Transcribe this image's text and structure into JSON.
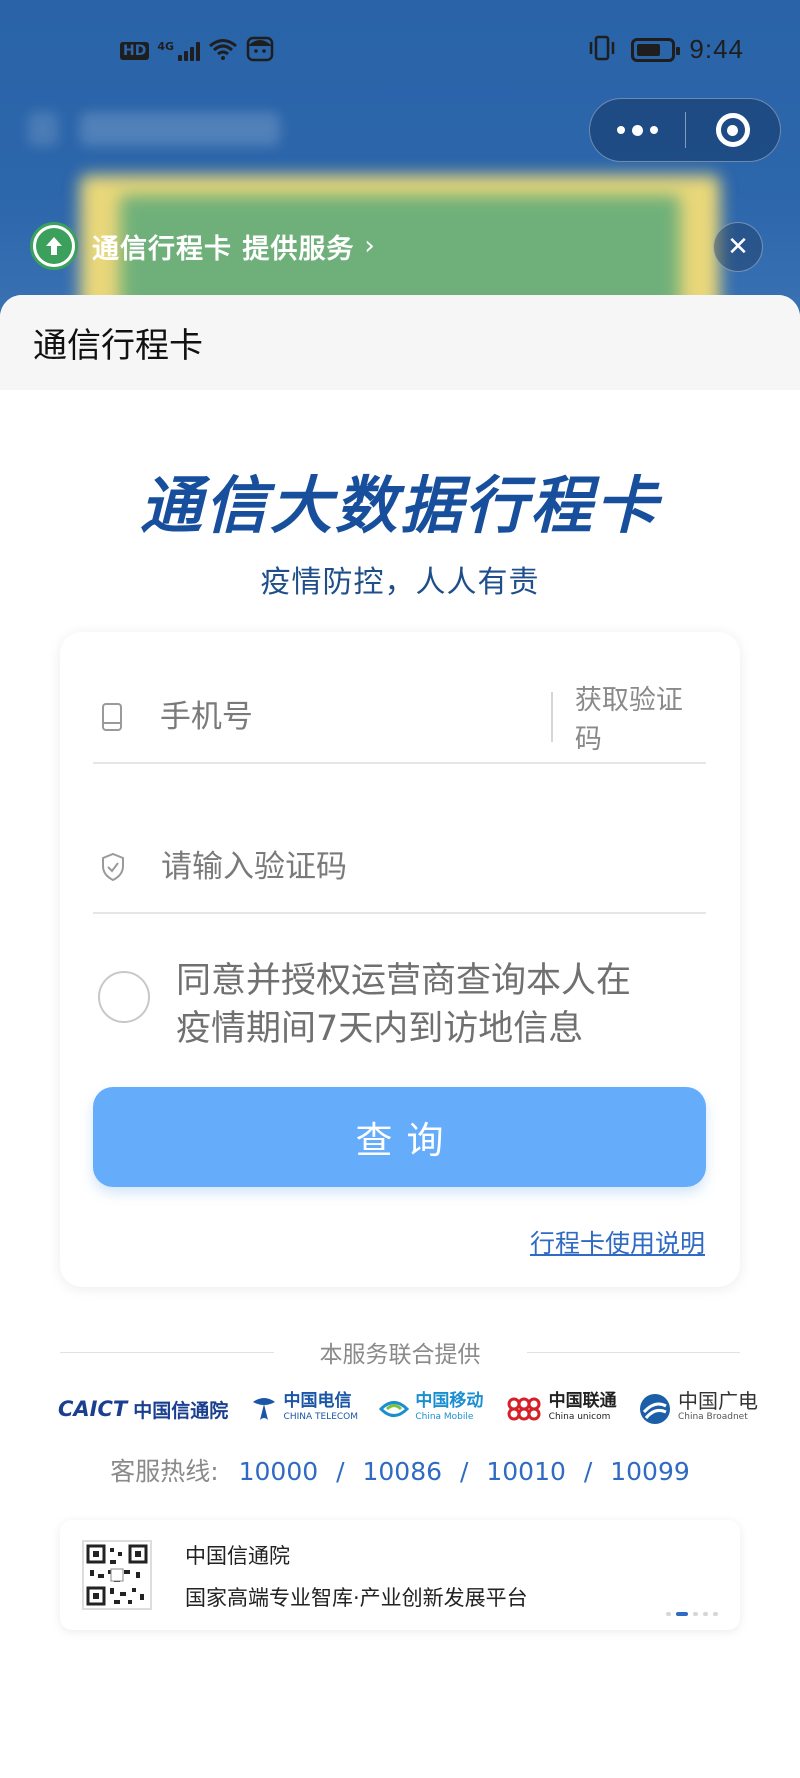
{
  "status_bar": {
    "hd": "HD",
    "network": "4G",
    "time": "9:44",
    "battery_level": 0.72
  },
  "capsule": {
    "more_icon": "more-dots-icon",
    "close_icon": "target-circle-icon"
  },
  "service_banner": {
    "text": "通信行程卡 提供服务",
    "chevron": "›",
    "close": "✕"
  },
  "sheet": {
    "title": "通信行程卡"
  },
  "hero": {
    "title": "通信大数据行程卡",
    "subtitle": "疫情防控，人人有责"
  },
  "form": {
    "phone_placeholder": "手机号",
    "get_code_label": "获取验证码",
    "code_placeholder": "请输入验证码",
    "consent_line1": "同意并授权运营商查询本人在",
    "consent_line2": "疫情期间7天内到访地信息",
    "submit_label": "查询",
    "guide_link": "行程卡使用说明"
  },
  "providers": {
    "heading": "本服务联合提供",
    "caict_en": "CAICT",
    "caict_cn": "中国信通院",
    "telecom_cn": "中国电信",
    "telecom_en": "CHINA TELECOM",
    "mobile_cn": "中国移动",
    "mobile_en": "China Mobile",
    "unicom_cn": "中国联通",
    "unicom_en": "China unicom",
    "broadnet_cn": "中国广电",
    "broadnet_en": "China Broadnet"
  },
  "hotline": {
    "label": "客服热线:",
    "numbers": [
      "10000",
      "10086",
      "10010",
      "10099"
    ],
    "separator": "/"
  },
  "promo": {
    "title": "中国信通院",
    "subtitle": "国家高端专业智库·产业创新发展平台"
  },
  "colors": {
    "brand_blue": "#174f9c",
    "button_blue": "#65acfa",
    "link_blue": "#2f6bc2"
  }
}
